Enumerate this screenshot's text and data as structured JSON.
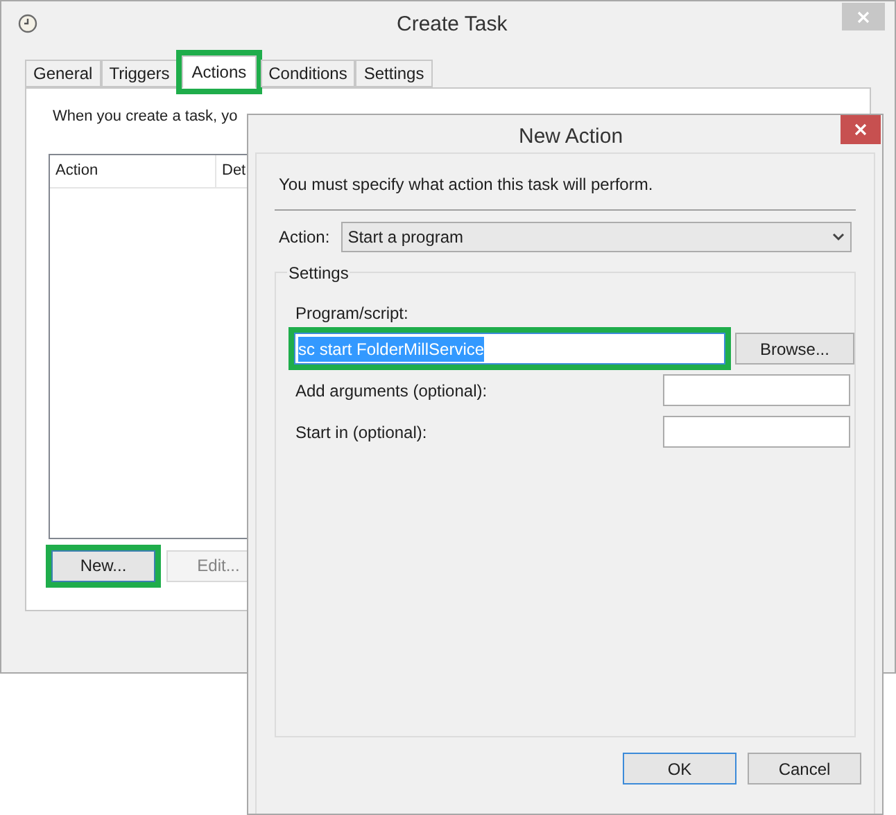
{
  "create_task": {
    "title": "Create Task",
    "tabs": [
      {
        "label": "General",
        "selected": false,
        "highlighted": false
      },
      {
        "label": "Triggers",
        "selected": false,
        "highlighted": false
      },
      {
        "label": "Actions",
        "selected": true,
        "highlighted": true
      },
      {
        "label": "Conditions",
        "selected": false,
        "highlighted": false
      },
      {
        "label": "Settings",
        "selected": false,
        "highlighted": false
      }
    ],
    "description": "When you create a task, yo",
    "table": {
      "columns": [
        "Action",
        "Det"
      ]
    },
    "buttons": [
      {
        "label": "New...",
        "highlighted": true,
        "focused": true,
        "disabled": false
      },
      {
        "label": "Edit...",
        "highlighted": false,
        "focused": false,
        "disabled": true
      }
    ]
  },
  "new_action": {
    "title": "New Action",
    "prompt": "You must specify what action this task will perform.",
    "action": {
      "label": "Action:",
      "value": "Start a program"
    },
    "settings": {
      "title": "Settings",
      "fields": [
        {
          "kind": "stacked",
          "label": "Program/script:",
          "value": "sc start FolderMillService",
          "text_selected": true,
          "highlighted": true,
          "button": "Browse..."
        },
        {
          "kind": "inline",
          "label": "Add arguments (optional):",
          "highlighted": false
        },
        {
          "kind": "inline",
          "label": "Start in (optional):",
          "highlighted": false
        }
      ]
    },
    "buttons": [
      {
        "label": "OK",
        "default": true
      },
      {
        "label": "Cancel",
        "default": false
      }
    ]
  }
}
